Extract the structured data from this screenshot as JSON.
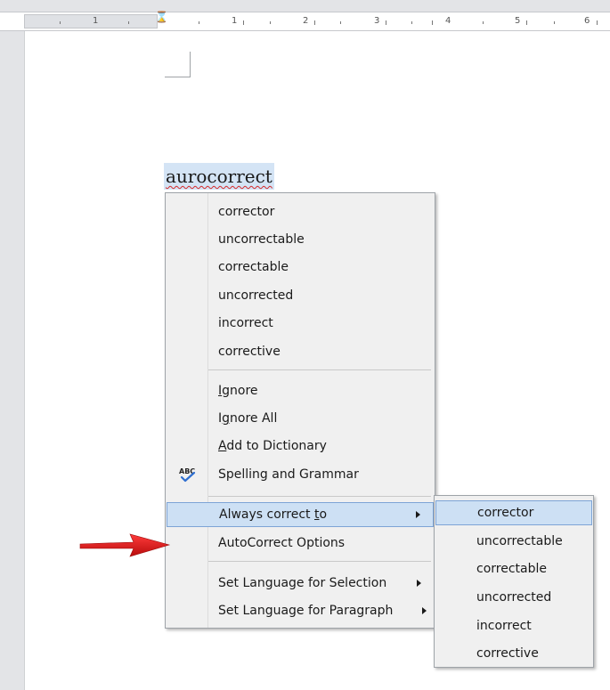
{
  "ruler": {
    "numbers": [
      "1",
      "1",
      "2",
      "3",
      "4",
      "5",
      "6"
    ]
  },
  "document": {
    "misspelled_word": "aurocorrect"
  },
  "context_menu": {
    "suggestions": [
      "corrector",
      "uncorrectable",
      "correctable",
      "uncorrected",
      "incorrect",
      "corrective"
    ],
    "ignore": {
      "underline": "I",
      "rest": "gnore"
    },
    "ignore_all": {
      "pre": "I",
      "underline": "g",
      "rest": "nore All"
    },
    "add_to_dictionary": {
      "underline": "A",
      "rest": "dd to Dictionary"
    },
    "spelling_and_grammar": "Spelling and Grammar",
    "always_correct_to": {
      "pre": "Always correct ",
      "underline": "t",
      "rest": "o"
    },
    "autocorrect_options": "AutoCorrect Options",
    "set_language_selection": "Set Language for Selection",
    "set_language_paragraph": "Set Language for Paragraph"
  },
  "submenu": {
    "items": [
      "corrector",
      "uncorrectable",
      "correctable",
      "uncorrected",
      "incorrect",
      "corrective"
    ]
  },
  "icons": {
    "spelling": "spelling-check-icon",
    "pointer": "red-arrow-icon"
  },
  "colors": {
    "highlight": "#cde0f4",
    "highlight_border": "#7da4d6",
    "squiggle": "#d62a2a",
    "arrow": "#e01a1a"
  }
}
